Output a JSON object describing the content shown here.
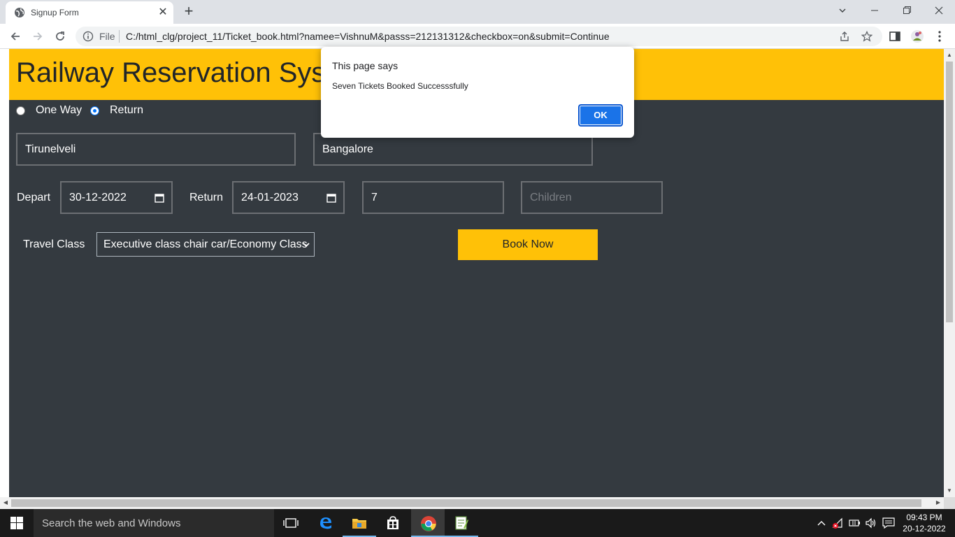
{
  "browser": {
    "tab_title": "Signup Form",
    "scheme": "File",
    "url": "C:/html_clg/project_11/Ticket_book.html?namee=VishnuM&passs=212131312&checkbox=on&submit=Continue"
  },
  "page": {
    "heading": "Railway Reservation System",
    "trip_options": [
      {
        "label": "One Way",
        "checked": false
      },
      {
        "label": "Return",
        "checked": true
      }
    ],
    "from_value": "Tirunelveli",
    "to_value": "Bangalore",
    "depart_label": "Depart",
    "depart_date": "30-12-2022",
    "return_label": "Return",
    "return_date": "24-01-2023",
    "adults_value": "7",
    "children_placeholder": "Children",
    "travel_class_label": "Travel Class",
    "travel_class_selected": "Executive class chair car/Economy Class",
    "book_button": "Book Now"
  },
  "dialog": {
    "title": "This page says",
    "message": "Seven Tickets Booked Successsfully",
    "ok_label": "OK"
  },
  "taskbar": {
    "search_placeholder": "Search the web and Windows",
    "time": "09:43 PM",
    "date": "20-12-2022"
  },
  "colors": {
    "header_bg": "#ffc107",
    "page_bg": "#343a40",
    "accent": "#1a73e8"
  }
}
